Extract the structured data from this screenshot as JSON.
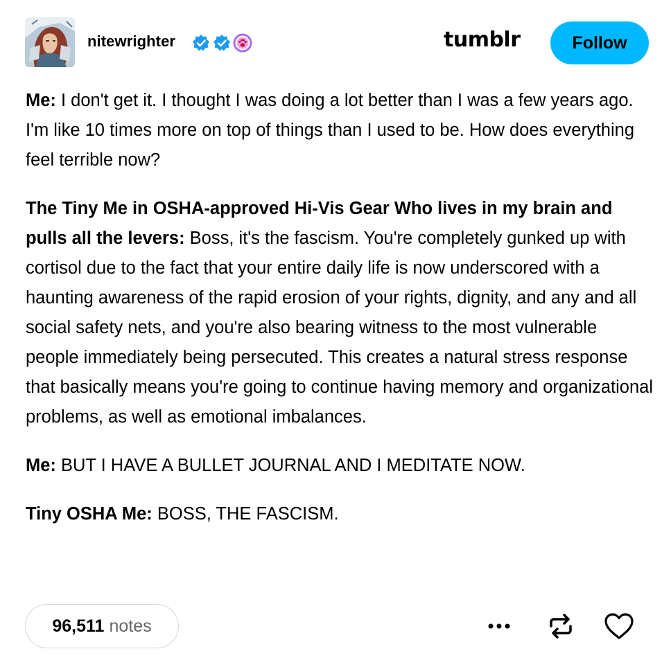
{
  "post": {
    "author": {
      "username": "nitewrighter",
      "badges": [
        "verified-check-badge",
        "verified-check-badge",
        "purple-paw-badge"
      ]
    },
    "brand": "tumblr",
    "follow_label": "Follow",
    "paragraphs": [
      {
        "speaker": "Me:",
        "text": " I don't get it. I thought I was doing a lot better than I was a few years ago. I'm like 10 times more on top of things than I used to be. How does everything feel terrible now?"
      },
      {
        "speaker": "The Tiny Me in OSHA-approved Hi-Vis Gear Who lives in my brain and pulls all the levers:",
        "text": " Boss, it's the fascism. You're completely gunked up with cortisol due to the fact that your entire daily life is now underscored with a haunting awareness of the rapid erosion of your rights, dignity, and any and all social safety nets, and you're also bearing witness to the most vulnerable people immediately being persecuted. This creates a natural stress response that basically means you're going to continue having memory and organizational problems, as well as emotional imbalances."
      },
      {
        "speaker": "Me:",
        "text": " BUT I HAVE A BULLET JOURNAL AND I MEDITATE NOW."
      },
      {
        "speaker": "Tiny OSHA Me:",
        "text": " BOSS, THE FASCISM."
      }
    ],
    "footer": {
      "notes_count": "96,511",
      "notes_label": "notes"
    }
  },
  "colors": {
    "accent": "#00b8ff",
    "verified": "#1d9bf0",
    "badge_purple": "#a66cf2",
    "text": "#000000",
    "muted": "#666666"
  },
  "icons": {
    "more": "ellipsis-icon",
    "reblog": "reblog-icon",
    "like": "heart-icon"
  }
}
